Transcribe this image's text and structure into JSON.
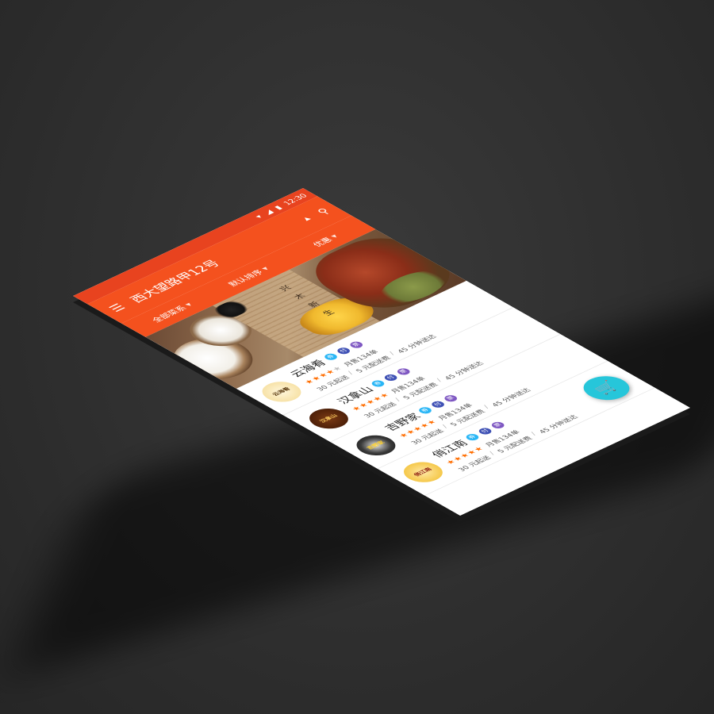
{
  "status_bar": {
    "time": "12:30",
    "wifi_icon": "wifi-icon",
    "signal_icon": "signal-icon",
    "battery_icon": "battery-icon"
  },
  "app_bar": {
    "menu_icon": "menu-icon",
    "title": "西大望路甲12号",
    "search_icon": "search-icon"
  },
  "filter_tabs": [
    {
      "label": "全部菜系"
    },
    {
      "label": "默认排序"
    },
    {
      "label": "优惠"
    }
  ],
  "banner": {
    "vertical_text": "兴 木 新 生"
  },
  "restaurants": [
    {
      "name": "云海肴",
      "logo_text": "云海肴",
      "badges": [
        "券",
        "付",
        "票"
      ],
      "rating": 4,
      "monthly_sales": "月售134单",
      "min_order": "30 元起送",
      "delivery_fee": "5 元配送费",
      "delivery_time": "45 分钟送达"
    },
    {
      "name": "汉拿山",
      "logo_text": "汉拿山",
      "badges": [
        "券",
        "付",
        "票"
      ],
      "rating": 5,
      "monthly_sales": "月售134单",
      "min_order": "30 元起送",
      "delivery_fee": "5 元配送费",
      "delivery_time": "45 分钟送达"
    },
    {
      "name": "吉野家",
      "logo_text": "吉野家",
      "badges": [
        "券",
        "付",
        "票"
      ],
      "rating": 5,
      "monthly_sales": "月售134单",
      "min_order": "30 元起送",
      "delivery_fee": "5 元配送费",
      "delivery_time": "45 分钟送达"
    },
    {
      "name": "俏江南",
      "logo_text": "俏江南",
      "badges": [
        "券",
        "付",
        "票"
      ],
      "rating": 5,
      "monthly_sales": "月售134单",
      "min_order": "30 元起送",
      "delivery_fee": "5 元配送费",
      "delivery_time": "45 分钟送达"
    }
  ],
  "fab": {
    "icon": "cart-icon"
  },
  "colors": {
    "primary": "#f4511e",
    "status": "#e8431f",
    "fab": "#26c6da",
    "star": "#ff6d00"
  }
}
